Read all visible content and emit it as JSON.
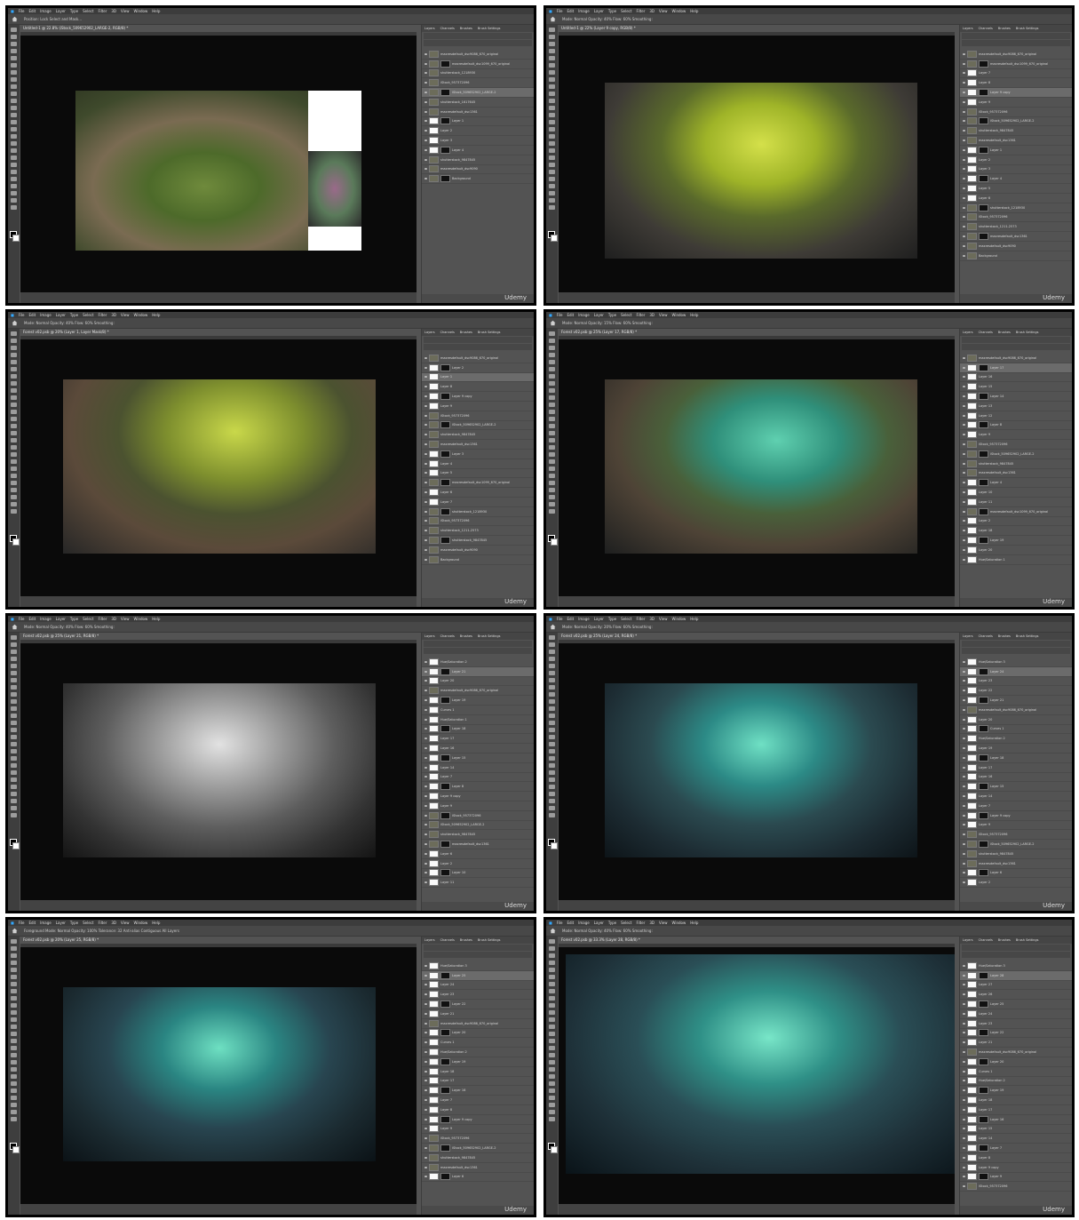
{
  "app": {
    "menu": [
      "File",
      "Edit",
      "Image",
      "Layer",
      "Type",
      "Select",
      "Filter",
      "3D",
      "View",
      "Window",
      "Help"
    ],
    "panel_tabs": [
      "Layers",
      "Channels",
      "Brushes",
      "Brush Settings"
    ],
    "watermark": "Udemy"
  },
  "frames": [
    {
      "doc_title": "Untitled-1 @ 22.8% (iStock_509652902_LARGE-2, RGB/8) *",
      "options": "Position:   Lock   Select and Mask...",
      "layers": [
        "maxresdefault_dsc9086_670_original",
        "maxresdefault_dsc1099_670_original",
        "shutterstock_1218930",
        "iStock_957372096",
        "iStock_509652902_LARGE-2",
        "shutterstock_1617645",
        "maxresdefault_dsc1361",
        "Layer 1",
        "Layer 2",
        "Layer 3",
        "Layer 4",
        "shutterstock_9847845",
        "maxresdefault_dsc9090",
        "Background"
      ],
      "selected_layer": 4
    },
    {
      "doc_title": "Untitled-1 @ 22% (Layer 9 copy, RGB/8) *",
      "options": "Mode: Normal   Opacity: 40%   Flow: 60%   Smoothing:",
      "layers": [
        "maxresdefault_dsc9086_670_original",
        "maxresdefault_dsc1099_670_original",
        "Layer 7",
        "Layer 8",
        "Layer 9 copy",
        "Layer 9",
        "iStock_957372096",
        "iStock_509652902_LARGE-2",
        "shutterstock_9847845",
        "maxresdefault_dsc1361",
        "Layer 1",
        "Layer 2",
        "Layer 3",
        "Layer 4",
        "Layer 5",
        "Layer 6",
        "shutterstock_1218930",
        "iStock_957372096",
        "shutterstock_1211-2573",
        "maxresdefault_dsc1361",
        "maxresdefault_dsc9090",
        "Background"
      ],
      "selected_layer": 4
    },
    {
      "doc_title": "Forest v02.psb @ 20% (Layer 1, Layer Mask/8) *",
      "options": "Mode: Normal   Opacity: 40%   Flow: 60%   Smoothing:",
      "layers": [
        "maxresdefault_dsc9086_670_original",
        "Layer 2",
        "Layer 1",
        "Layer 8",
        "Layer 9 copy",
        "Layer 9",
        "iStock_957372096",
        "iStock_509652902_LARGE-2",
        "shutterstock_9847845",
        "maxresdefault_dsc1361",
        "Layer 3",
        "Layer 4",
        "Layer 5",
        "maxresdefault_dsc1099_670_original",
        "Layer 6",
        "Layer 7",
        "shutterstock_1218930",
        "iStock_957372096",
        "shutterstock_1211-2573",
        "shutterstock_9847845",
        "maxresdefault_dsc9090",
        "Background"
      ],
      "selected_layer": 2
    },
    {
      "doc_title": "Forest v02.psb @ 25% (Layer 17, RGB/8) *",
      "options": "Mode: Normal   Opacity: 15%   Flow: 60%   Smoothing:",
      "layers": [
        "maxresdefault_dsc9086_670_original",
        "Layer 17",
        "Layer 16",
        "Layer 15",
        "Layer 14",
        "Layer 13",
        "Layer 12",
        "Layer 8",
        "Layer 9",
        "iStock_957372096",
        "iStock_509652902_LARGE-2",
        "shutterstock_9847845",
        "maxresdefault_dsc1361",
        "Layer 4",
        "Layer 10",
        "Layer 11",
        "maxresdefault_dsc1099_670_original",
        "Layer 2",
        "Layer 18",
        "Layer 19",
        "Layer 20",
        "Hue/Saturation 1"
      ],
      "selected_layer": 1
    },
    {
      "doc_title": "Forest v02.psb @ 25% (Layer 21, RGB/8) *",
      "options": "Mode: Normal   Opacity: 40%   Flow: 60%   Smoothing:",
      "layers": [
        "Hue/Saturation 2",
        "Layer 21",
        "Layer 20",
        "maxresdefault_dsc9086_670_original",
        "Layer 19",
        "Curves 1",
        "Hue/Saturation 1",
        "Layer 18",
        "Layer 17",
        "Layer 16",
        "Layer 15",
        "Layer 14",
        "Layer 7",
        "Layer 8",
        "Layer 9 copy",
        "Layer 9",
        "iStock_957372096",
        "iStock_509652902_LARGE-2",
        "shutterstock_9847845",
        "maxresdefault_dsc1361",
        "Layer 6",
        "Layer 2",
        "Layer 10",
        "Layer 11"
      ],
      "selected_layer": 1
    },
    {
      "doc_title": "Forest v02.psb @ 25% (Layer 24, RGB/8) *",
      "options": "Mode: Normal   Opacity: 20%   Flow: 60%   Smoothing:",
      "layers": [
        "Hue/Saturation 3",
        "Layer 24",
        "Layer 23",
        "Layer 22",
        "Layer 21",
        "maxresdefault_dsc9086_670_original",
        "Layer 20",
        "Curves 1",
        "Hue/Saturation 2",
        "Layer 19",
        "Layer 18",
        "Layer 17",
        "Layer 16",
        "Layer 15",
        "Layer 14",
        "Layer 7",
        "Layer 9 copy",
        "Layer 9",
        "iStock_957372096",
        "iStock_509652902_LARGE-2",
        "shutterstock_9847845",
        "maxresdefault_dsc1361",
        "Layer 6",
        "Layer 2"
      ],
      "selected_layer": 1
    },
    {
      "doc_title": "Forest v02.psb @ 20% (Layer 25, RGB/8) *",
      "options": "Foreground   Mode: Normal   Opacity: 100%   Tolerance: 32   Anti-alias   Contiguous   All Layers",
      "layers": [
        "Hue/Saturation 3",
        "Layer 25",
        "Layer 24",
        "Layer 23",
        "Layer 22",
        "Layer 21",
        "maxresdefault_dsc9086_670_original",
        "Layer 20",
        "Curves 1",
        "Hue/Saturation 2",
        "Layer 19",
        "Layer 18",
        "Layer 17",
        "Layer 16",
        "Layer 7",
        "Layer 8",
        "Layer 9 copy",
        "Layer 9",
        "iStock_957372096",
        "iStock_509652902_LARGE-2",
        "shutterstock_9847845",
        "maxresdefault_dsc1361",
        "Layer 6"
      ],
      "selected_layer": 1
    },
    {
      "doc_title": "Forest v02.psb @ 33.3% (Layer 28, RGB/8) *",
      "options": "Mode: Normal   Opacity: 40%   Flow: 60%   Smoothing:",
      "layers": [
        "Hue/Saturation 3",
        "Layer 28",
        "Layer 27",
        "Layer 26",
        "Layer 25",
        "Layer 24",
        "Layer 23",
        "Layer 22",
        "Layer 21",
        "maxresdefault_dsc9086_670_original",
        "Layer 20",
        "Curves 1",
        "Hue/Saturation 2",
        "Layer 19",
        "Layer 18",
        "Layer 17",
        "Layer 16",
        "Layer 15",
        "Layer 14",
        "Layer 7",
        "Layer 8",
        "Layer 9 copy",
        "Layer 9",
        "iStock_957372096"
      ],
      "selected_layer": 1
    }
  ]
}
